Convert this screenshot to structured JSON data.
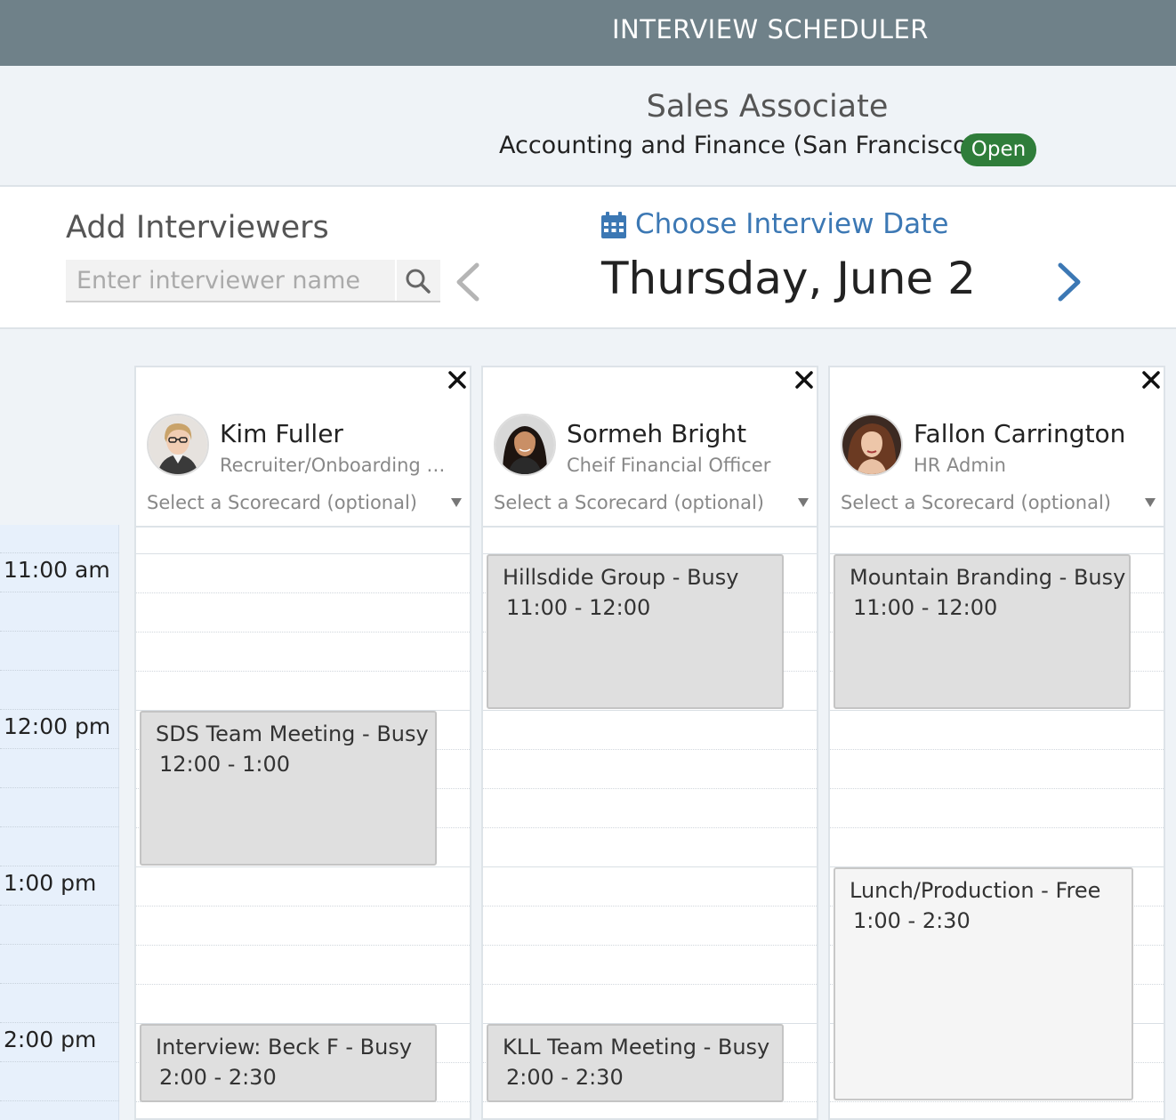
{
  "header": {
    "title": "INTERVIEW SCHEDULER"
  },
  "job": {
    "title": "Sales Associate",
    "department": "Accounting and Finance (San Francisco)",
    "status": "Open",
    "status_color": "#2f7d3a"
  },
  "controls": {
    "add_label": "Add Interviewers",
    "search_placeholder": "Enter interviewer name",
    "search_icon": "search-icon",
    "choose_date_label": "Choose Interview Date",
    "calendar_icon": "calendar-icon",
    "current_date": "Thursday, June 2",
    "prev_icon": "chevron-left-icon",
    "next_icon": "chevron-right-icon",
    "accent_color": "#3c78b4"
  },
  "time_slots": [
    "11:00 am",
    "12:00 pm",
    "1:00 pm",
    "2:00 pm"
  ],
  "interviewers": [
    {
      "name": "Kim Fuller",
      "role": "Recruiter/Onboarding Specialist",
      "scorecard_placeholder": "Select a Scorecard (optional)",
      "events": [
        {
          "title": "SDS Team Meeting - Busy",
          "time": "12:00 - 1:00",
          "status": "busy"
        },
        {
          "title": "Interview: Beck F - Busy",
          "time": "2:00 - 2:30",
          "status": "busy"
        }
      ]
    },
    {
      "name": "Sormeh Bright",
      "role": "Cheif Financial Officer",
      "scorecard_placeholder": "Select a Scorecard (optional)",
      "events": [
        {
          "title": "Hillsdide Group - Busy",
          "time": "11:00 - 12:00",
          "status": "busy"
        },
        {
          "title": "KLL Team Meeting - Busy",
          "time": "2:00 - 2:30",
          "status": "busy"
        }
      ]
    },
    {
      "name": "Fallon Carrington",
      "role": "HR Admin",
      "scorecard_placeholder": "Select a Scorecard (optional)",
      "events": [
        {
          "title": "Mountain Branding - Busy",
          "time": "11:00 - 12:00",
          "status": "busy"
        },
        {
          "title": "Lunch/Production - Free",
          "time": "1:00 - 2:30",
          "status": "free"
        }
      ]
    }
  ]
}
